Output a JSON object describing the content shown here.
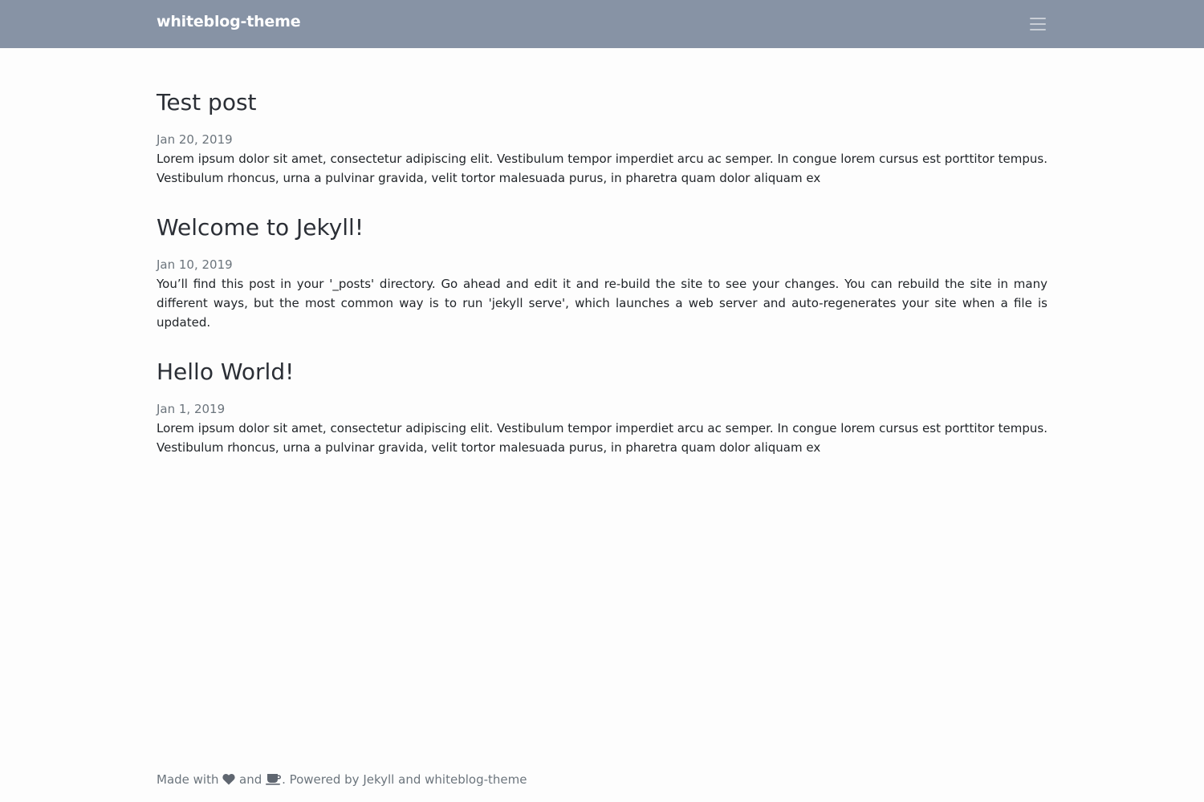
{
  "header": {
    "brand": "whiteblog-theme",
    "menu_icon": "hamburger-menu-icon",
    "background_color": "#8793a5"
  },
  "posts": [
    {
      "title": "Test post",
      "date": "Jan 20, 2019",
      "excerpt": "Lorem ipsum dolor sit amet, consectetur adipiscing elit. Vestibulum tempor imperdiet arcu ac semper. In congue lorem cursus est porttitor tempus. Vestibulum rhoncus, urna a pulvinar gravida, velit tortor malesuada purus, in pharetra quam dolor aliquam ex"
    },
    {
      "title": "Welcome to Jekyll!",
      "date": "Jan 10, 2019",
      "excerpt": "You’ll find this post in your '_posts' directory. Go ahead and edit it and re-build the site to see your changes. You can rebuild the site in many different ways, but the most common way is to run 'jekyll serve', which launches a web server and auto-regenerates your site when a file is updated."
    },
    {
      "title": "Hello World!",
      "date": "Jan 1, 2019",
      "excerpt": "Lorem ipsum dolor sit amet, consectetur adipiscing elit. Vestibulum tempor imperdiet arcu ac semper. In congue lorem cursus est porttitor tempus. Vestibulum rhoncus, urna a pulvinar gravida, velit tortor malesuada purus, in pharetra quam dolor aliquam ex"
    }
  ],
  "footer": {
    "made_with": "Made with",
    "heart_icon": "heart-icon",
    "and": "and",
    "coffee_icon": "coffee-icon",
    "powered_by": ". Powered by",
    "jekyll_link": "Jekyll",
    "and_2": "and",
    "theme_link": "whiteblog-theme"
  }
}
